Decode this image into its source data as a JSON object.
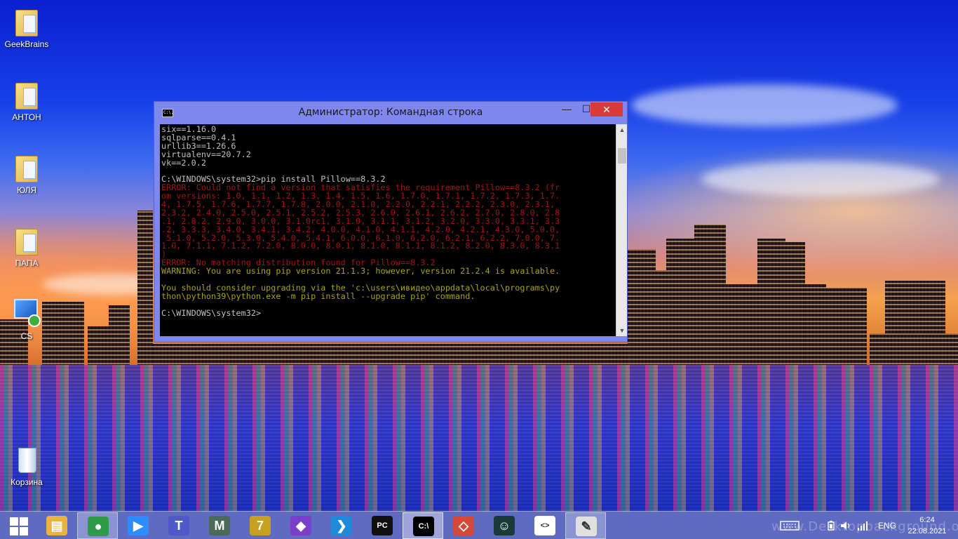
{
  "desktop": {
    "icons": [
      {
        "label": "GeekBrains",
        "icon": "folder-icon"
      },
      {
        "label": "АНТОН",
        "icon": "folder-icon"
      },
      {
        "label": "ЮЛЯ",
        "icon": "folder-icon"
      },
      {
        "label": "ПАПА",
        "icon": "folder-icon"
      },
      {
        "label": "CS",
        "icon": "network-computer-icon"
      },
      {
        "label": "Корзина",
        "icon": "recycle-bin-icon"
      }
    ]
  },
  "window": {
    "title": "Администратор: Командная строка",
    "icon_text": "C:\\.",
    "minimize": "—",
    "maximize": "☐",
    "close": "✕"
  },
  "console": {
    "lines": [
      {
        "text": "six==1.16.0",
        "kind": "normal"
      },
      {
        "text": "sqlparse==0.4.1",
        "kind": "normal"
      },
      {
        "text": "urllib3==1.26.6",
        "kind": "normal"
      },
      {
        "text": "virtualenv==20.7.2",
        "kind": "normal"
      },
      {
        "text": "vk==2.0.2",
        "kind": "normal"
      },
      {
        "text": "",
        "kind": "normal"
      },
      {
        "text": "C:\\WINDOWS\\system32>pip install Pillow==8.3.2",
        "kind": "normal"
      },
      {
        "text": "ERROR: Could not find a version that satisfies the requirement Pillow==8.3.2 (fr",
        "kind": "err"
      },
      {
        "text": "om versions: 1.0, 1.1, 1.2, 1.3, 1.4, 1.5, 1.6, 1.7.0, 1.7.1, 1.7.2, 1.7.3, 1.7.",
        "kind": "err"
      },
      {
        "text": "4, 1.7.5, 1.7.6, 1.7.7, 1.7.8, 2.0.0, 2.1.0, 2.2.0, 2.2.1, 2.2.2, 2.3.0, 2.3.1,",
        "kind": "err"
      },
      {
        "text": "2.3.2, 2.4.0, 2.5.0, 2.5.1, 2.5.2, 2.5.3, 2.6.0, 2.6.1, 2.6.2, 2.7.0, 2.8.0, 2.8",
        "kind": "err"
      },
      {
        "text": ".1, 2.8.2, 2.9.0, 3.0.0, 3.1.0rc1, 3.1.0, 3.1.1, 3.1.2, 3.2.0, 3.3.0, 3.3.1, 3.3",
        "kind": "err"
      },
      {
        "text": ".2, 3.3.3, 3.4.0, 3.4.1, 3.4.2, 4.0.0, 4.1.0, 4.1.1, 4.2.0, 4.2.1, 4.3.0, 5.0.0,",
        "kind": "err"
      },
      {
        "text": " 5.1.0, 5.2.0, 5.3.0, 5.4.0, 5.4.1, 6.0.0, 6.1.0, 6.2.0, 6.2.1, 6.2.2, 7.0.0, 7.",
        "kind": "err"
      },
      {
        "text": "1.0, 7.1.1, 7.1.2, 7.2.0, 8.0.0, 8.0.1, 8.1.0, 8.1.1, 8.1.2, 8.2.0, 8.3.0, 8.3.1",
        "kind": "err"
      },
      {
        "text": ")",
        "kind": "err"
      },
      {
        "text": "ERROR: No matching distribution found for Pillow==8.3.2",
        "kind": "err"
      },
      {
        "text": "WARNING: You are using pip version 21.1.3; however, version 21.2.4 is available.",
        "kind": "warn"
      },
      {
        "text": "",
        "kind": "warn"
      },
      {
        "text": "You should consider upgrading via the 'c:\\users\\ивидео\\appdata\\local\\programs\\py",
        "kind": "warn"
      },
      {
        "text": "thon\\python39\\python.exe -m pip install --upgrade pip' command.",
        "kind": "warn"
      },
      {
        "text": "",
        "kind": "normal"
      },
      {
        "text": "C:\\WINDOWS\\system32>",
        "kind": "normal"
      }
    ]
  },
  "taskbar": {
    "apps": [
      {
        "name": "file-explorer",
        "icon": "folder-icon",
        "color": "#e8b440",
        "glyph": "▤",
        "state": "normal"
      },
      {
        "name": "chrome",
        "icon": "chrome-icon",
        "color": "#2e9b48",
        "glyph": "●",
        "state": "active"
      },
      {
        "name": "zoom",
        "icon": "zoom-icon",
        "color": "#2d8cff",
        "glyph": "▶",
        "state": "normal"
      },
      {
        "name": "teams",
        "icon": "teams-icon",
        "color": "#5059c9",
        "glyph": "T",
        "state": "normal"
      },
      {
        "name": "mendeley",
        "icon": "m-icon",
        "color": "#4a6a5a",
        "glyph": "M",
        "state": "normal"
      },
      {
        "name": "7zip",
        "icon": "seven-icon",
        "color": "#c8a020",
        "glyph": "7",
        "state": "normal"
      },
      {
        "name": "visual-studio",
        "icon": "visual-studio-icon",
        "color": "#7a3fc9",
        "glyph": "◆",
        "state": "normal"
      },
      {
        "name": "vscode",
        "icon": "vscode-icon",
        "color": "#1f8ad8",
        "glyph": "❯",
        "state": "normal"
      },
      {
        "name": "pycharm",
        "icon": "pycharm-icon",
        "color": "#111111",
        "glyph": "PC",
        "state": "normal"
      },
      {
        "name": "cmd",
        "icon": "command-prompt-icon",
        "color": "#000000",
        "glyph": "C:\\",
        "state": "current"
      },
      {
        "name": "git",
        "icon": "git-icon",
        "color": "#d44a3a",
        "glyph": "◇",
        "state": "normal"
      },
      {
        "name": "gitkraken",
        "icon": "gitkraken-icon",
        "color": "#1a3a3a",
        "glyph": "☺",
        "state": "normal"
      },
      {
        "name": "code-editor",
        "icon": "code-editor-icon",
        "color": "#ffffff",
        "glyph": "<>",
        "state": "normal"
      },
      {
        "name": "paint",
        "icon": "paint-icon",
        "color": "#e0e0e0",
        "glyph": "✎",
        "state": "active"
      }
    ],
    "language": "ENG",
    "time": "6:24",
    "date": "22.08.2021"
  },
  "watermark": "www.Desktopbackground.org"
}
